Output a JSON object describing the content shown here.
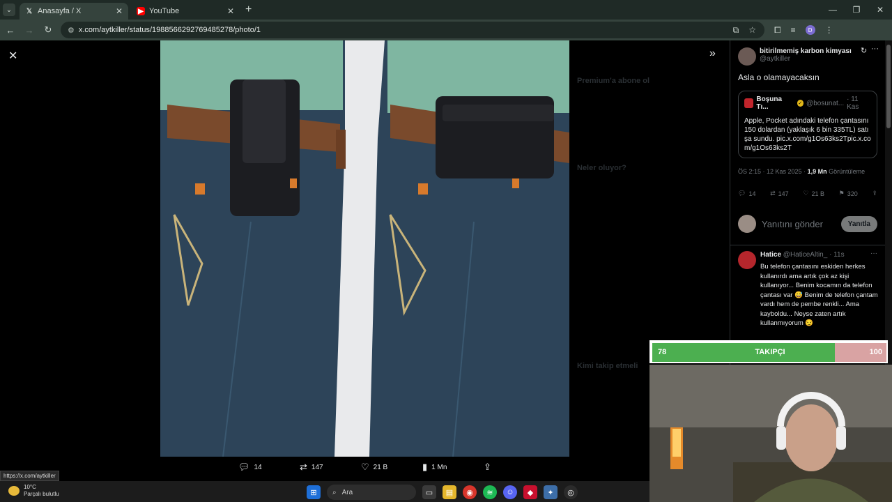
{
  "browser": {
    "tabs": [
      {
        "title": "Anasayfa / X",
        "active": true
      },
      {
        "title": "YouTube",
        "active": false
      }
    ],
    "url": "x.com/aytkiller/status/1988566292769485278/photo/1",
    "status_link": "https://x.com/aytkiller",
    "profile_initial": "D"
  },
  "actions": {
    "replies": "14",
    "retweets": "147",
    "likes": "21 B",
    "views": "1 Mn"
  },
  "tweet": {
    "author_name": "bitirilmemiş karbon kimyası",
    "author_handle": "@aytkiller",
    "text": "Asla o olamayacaksın",
    "quote": {
      "name": "Boşuna Tı...",
      "handle": "@bosunat...",
      "time": "· 11 Kas",
      "text": "Apple, Pocket adındaki telefon çantasını 150 dolardan (yaklaşık 6 bin 335TL) satışa sundu. pic.x.com/g1Os63ks2Tpic.x.com/g1Os63ks2T"
    },
    "meta_time": "ÖS 2:15 · 12 Kas 2025 ·",
    "meta_views": "1,9 Mn",
    "meta_views_label": "Görüntüleme",
    "stats": {
      "replies": "14",
      "retweets": "147",
      "likes": "21 B",
      "bookmarks": "320"
    },
    "reply_placeholder": "Yanıtını gönder",
    "reply_button": "Yanıtla"
  },
  "reply": {
    "name": "Hatice",
    "handle": "@HaticeAltin_ · 11s",
    "text": "Bu telefon çantasını eskiden herkes kullanırdı ama artık çok az kişi kullanıyor... Benim kocamın da telefon çantası var 😅 Benim de telefon çantam vardı hem de pembe renkli... Ama kayboldu... Neyse zaten artık kullanmıyorum 😏"
  },
  "overlay": {
    "current": "78",
    "label": "TAKIPÇI",
    "goal": "100",
    "fill_fraction": 0.78
  },
  "background_sidebar": {
    "premium": "Premium'a abone ol",
    "whats_happening": "Neler oluyor?",
    "who_to_follow": "Kimi takip etmeli"
  },
  "taskbar": {
    "temp": "10°C",
    "weather": "Parçalı bulutlu",
    "search": "Ara"
  },
  "colors": {
    "accent_green": "#4caf50",
    "bar_remainder": "#d9a3a3",
    "x_background": "#000000"
  }
}
